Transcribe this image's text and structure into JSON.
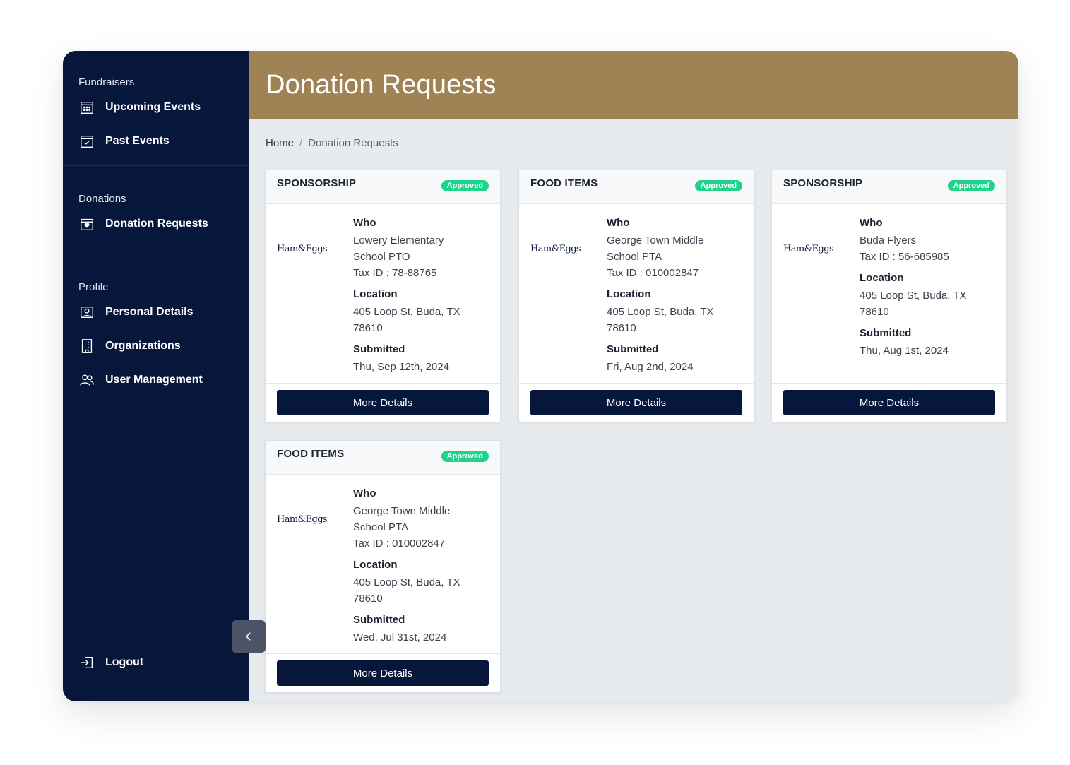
{
  "header": {
    "title": "Donation Requests"
  },
  "breadcrumb": {
    "home": "Home",
    "separator": "/",
    "current": "Donation Requests"
  },
  "sidebar": {
    "sections": [
      {
        "label": "Fundraisers",
        "items": [
          {
            "label": "Upcoming Events",
            "icon": "calendar-grid-icon"
          },
          {
            "label": "Past Events",
            "icon": "calendar-check-icon"
          }
        ]
      },
      {
        "label": "Donations",
        "items": [
          {
            "label": "Donation Requests",
            "icon": "donation-box-icon"
          }
        ]
      },
      {
        "label": "Profile",
        "items": [
          {
            "label": "Personal Details",
            "icon": "id-card-icon"
          },
          {
            "label": "Organizations",
            "icon": "building-icon"
          },
          {
            "label": "User Management",
            "icon": "users-icon"
          }
        ]
      }
    ],
    "logout": {
      "label": "Logout",
      "icon": "logout-icon"
    }
  },
  "cards": [
    {
      "type": "SPONSORSHIP",
      "status": "Approved",
      "logo": "Ham&Eggs",
      "who_label": "Who",
      "who_lines": [
        "Lowery Elementary",
        "School PTO"
      ],
      "tax": "Tax ID : 78-88765",
      "location_label": "Location",
      "location_lines": [
        "405 Loop St, Buda, TX",
        "78610"
      ],
      "submitted_label": "Submitted",
      "submitted": "Thu, Sep 12th, 2024",
      "button": "More Details"
    },
    {
      "type": "FOOD ITEMS",
      "status": "Approved",
      "logo": "Ham&Eggs",
      "who_label": "Who",
      "who_lines": [
        "George Town Middle",
        "School PTA"
      ],
      "tax": "Tax ID : 010002847",
      "location_label": "Location",
      "location_lines": [
        "405 Loop St, Buda, TX",
        "78610"
      ],
      "submitted_label": "Submitted",
      "submitted": "Fri, Aug 2nd, 2024",
      "button": "More Details"
    },
    {
      "type": "SPONSORSHIP",
      "status": "Approved",
      "logo": "Ham&Eggs",
      "who_label": "Who",
      "who_lines": [
        "Buda Flyers"
      ],
      "tax": "Tax ID : 56-685985",
      "location_label": "Location",
      "location_lines": [
        "405 Loop St, Buda, TX",
        "78610"
      ],
      "submitted_label": "Submitted",
      "submitted": "Thu, Aug 1st, 2024",
      "button": "More Details"
    },
    {
      "type": "FOOD ITEMS",
      "status": "Approved",
      "logo": "Ham&Eggs",
      "who_label": "Who",
      "who_lines": [
        "George Town Middle",
        "School PTA"
      ],
      "tax": "Tax ID : 010002847",
      "location_label": "Location",
      "location_lines": [
        "405 Loop St, Buda, TX",
        "78610"
      ],
      "submitted_label": "Submitted",
      "submitted": "Wed, Jul 31st, 2024",
      "button": "More Details"
    }
  ],
  "colors": {
    "sidebar": "#07163b",
    "header": "#a08355",
    "badge": "#1ed38a",
    "background": "#e8ebee"
  }
}
